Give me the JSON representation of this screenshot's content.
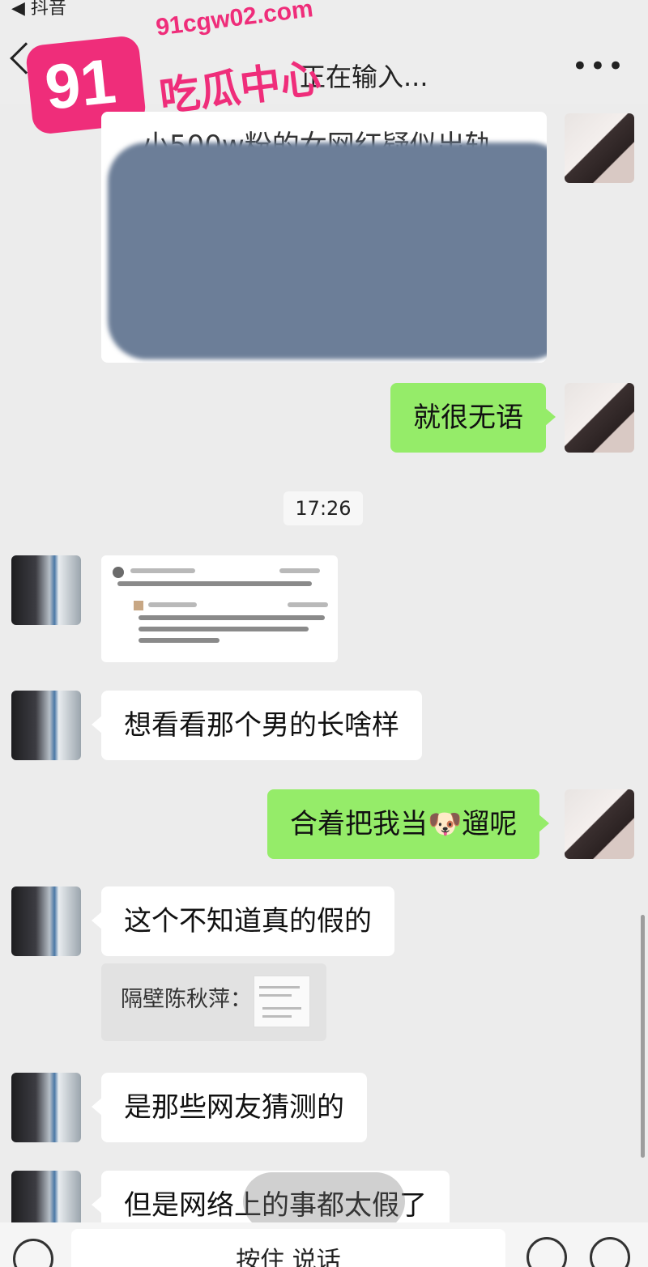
{
  "status_bar": {
    "back_app": "◀ 抖音"
  },
  "header": {
    "title": "正在输入...",
    "more": "•••"
  },
  "watermark": {
    "number": "91",
    "domain": "91cgw02.com",
    "name": "吃瓜中心"
  },
  "messages": {
    "blurred_peek": "小500w粉的女网红疑似出轨",
    "m1": "就很无语",
    "time": "17:26",
    "m2": "想看看那个男的长啥样",
    "m3_pre": "合着把我当",
    "m3_emoji": "🐶",
    "m3_post": "遛呢",
    "m4": "这个不知道真的假的",
    "quote": "隔壁陈秋萍：",
    "m5": "是那些网友猜测的",
    "m6": "但是网络上的事都太假了"
  },
  "input": {
    "press_to_talk": "按住 说话"
  }
}
